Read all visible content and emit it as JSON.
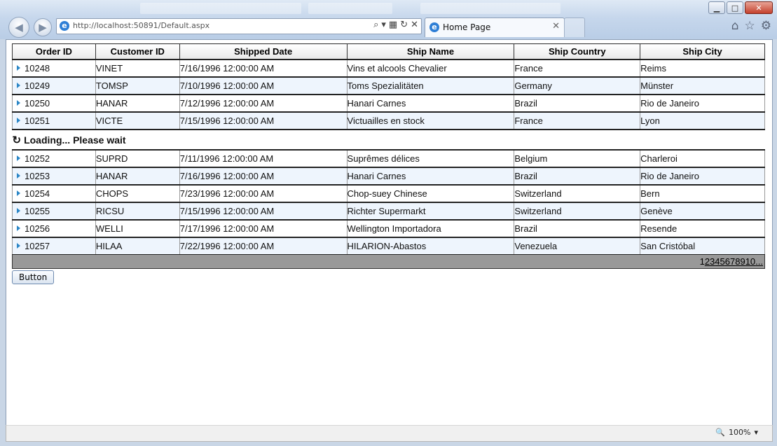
{
  "browser": {
    "url": "http://localhost:50891/Default.aspx",
    "tab_title": "Home Page",
    "zoom": "100%"
  },
  "grid": {
    "columns": [
      "Order ID",
      "Customer ID",
      "Shipped Date",
      "Ship Name",
      "Ship Country",
      "Ship City"
    ],
    "rows_before": [
      [
        "10248",
        "VINET",
        "7/16/1996 12:00:00 AM",
        "Vins et alcools Chevalier",
        "France",
        "Reims"
      ],
      [
        "10249",
        "TOMSP",
        "7/10/1996 12:00:00 AM",
        "Toms Spezialitäten",
        "Germany",
        "Münster"
      ],
      [
        "10250",
        "HANAR",
        "7/12/1996 12:00:00 AM",
        "Hanari Carnes",
        "Brazil",
        "Rio de Janeiro"
      ],
      [
        "10251",
        "VICTE",
        "7/15/1996 12:00:00 AM",
        "Victuailles en stock",
        "France",
        "Lyon"
      ]
    ],
    "loading_text": "Loading... Please wait",
    "rows_after": [
      [
        "10252",
        "SUPRD",
        "7/11/1996 12:00:00 AM",
        "Suprêmes délices",
        "Belgium",
        "Charleroi"
      ],
      [
        "10253",
        "HANAR",
        "7/16/1996 12:00:00 AM",
        "Hanari Carnes",
        "Brazil",
        "Rio de Janeiro"
      ],
      [
        "10254",
        "CHOPS",
        "7/23/1996 12:00:00 AM",
        "Chop-suey Chinese",
        "Switzerland",
        "Bern"
      ],
      [
        "10255",
        "RICSU",
        "7/15/1996 12:00:00 AM",
        "Richter Supermarkt",
        "Switzerland",
        "Genève"
      ],
      [
        "10256",
        "WELLI",
        "7/17/1996 12:00:00 AM",
        "Wellington Importadora",
        "Brazil",
        "Resende"
      ],
      [
        "10257",
        "HILAA",
        "7/22/1996 12:00:00 AM",
        "HILARION-Abastos",
        "Venezuela",
        "San Cristóbal"
      ]
    ],
    "pager": {
      "current": "1",
      "pages": [
        "2",
        "3",
        "4",
        "5",
        "6",
        "7",
        "8",
        "9",
        "10",
        "..."
      ]
    }
  },
  "button_label": "Button"
}
